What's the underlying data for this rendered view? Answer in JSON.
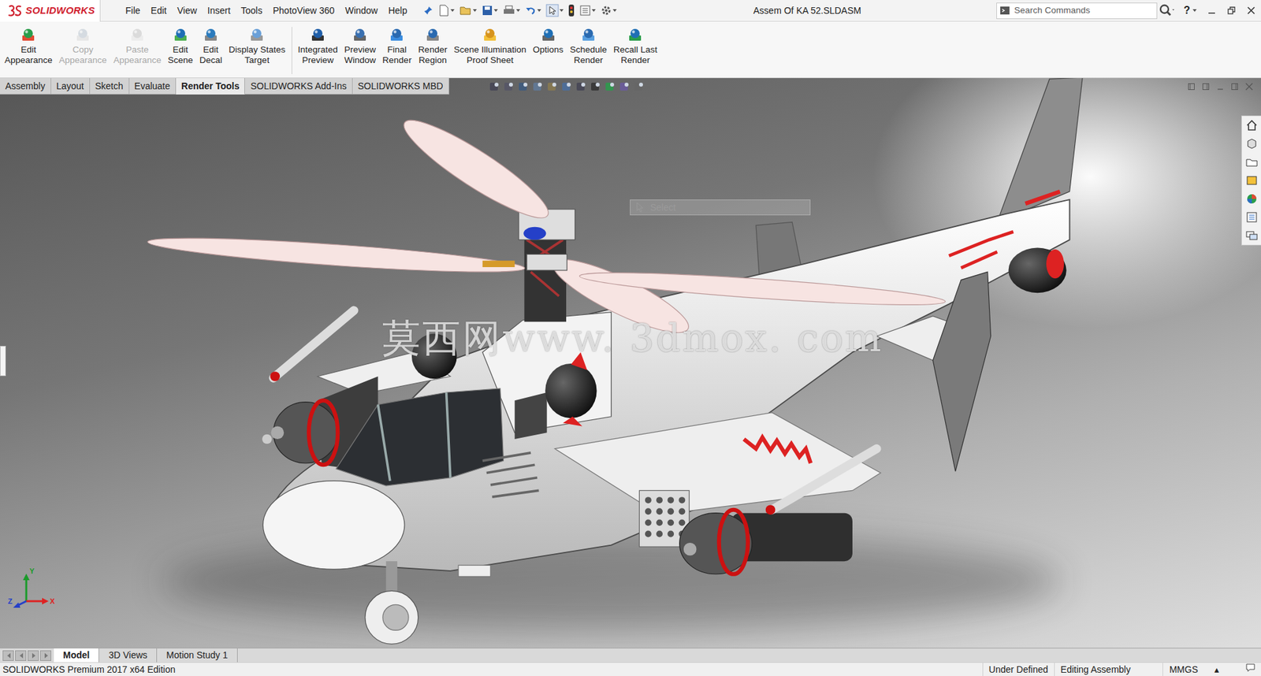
{
  "app": {
    "logo": "SOLIDWORKS"
  },
  "menu": [
    "File",
    "Edit",
    "View",
    "Insert",
    "Tools",
    "PhotoView 360",
    "Window",
    "Help"
  ],
  "window": {
    "title": "Assem Of KA 52.SLDASM"
  },
  "search": {
    "placeholder": "Search Commands"
  },
  "help": "?",
  "ribbon": {
    "groups": [
      [
        {
          "lines": [
            "Edit",
            "Appearance"
          ],
          "disabled": false
        },
        {
          "lines": [
            "Copy",
            "Appearance"
          ],
          "disabled": true
        },
        {
          "lines": [
            "Paste",
            "Appearance"
          ],
          "disabled": true
        },
        {
          "lines": [
            "Edit",
            "Scene"
          ],
          "disabled": false
        },
        {
          "lines": [
            "Edit",
            "Decal"
          ],
          "disabled": false
        },
        {
          "lines": [
            "Display States",
            "Target"
          ],
          "disabled": false
        }
      ],
      [
        {
          "lines": [
            "Integrated",
            "Preview"
          ],
          "disabled": false
        },
        {
          "lines": [
            "Preview",
            "Window"
          ],
          "disabled": false
        },
        {
          "lines": [
            "Final",
            "Render"
          ],
          "disabled": false
        },
        {
          "lines": [
            "Render",
            "Region"
          ],
          "disabled": false
        },
        {
          "lines": [
            "Scene Illumination",
            "Proof Sheet"
          ],
          "disabled": false
        },
        {
          "lines": [
            "Options"
          ],
          "disabled": false
        },
        {
          "lines": [
            "Schedule",
            "Render"
          ],
          "disabled": false
        },
        {
          "lines": [
            "Recall Last",
            "Render"
          ],
          "disabled": false
        }
      ]
    ]
  },
  "tabs": [
    {
      "label": "Assembly",
      "selected": false
    },
    {
      "label": "Layout",
      "selected": false
    },
    {
      "label": "Sketch",
      "selected": false
    },
    {
      "label": "Evaluate",
      "selected": false
    },
    {
      "label": "Render Tools",
      "selected": true
    },
    {
      "label": "SOLIDWORKS Add-Ins",
      "selected": false
    },
    {
      "label": "SOLIDWORKS MBD",
      "selected": false
    }
  ],
  "viewport": {
    "tooltip": "Select",
    "watermark": "莫西网www. 3dmox. com"
  },
  "triad": {
    "y": "Y",
    "x": "X",
    "z": "Z"
  },
  "bottom_tabs": [
    {
      "label": "Model",
      "selected": true
    },
    {
      "label": "3D Views",
      "selected": false
    },
    {
      "label": "Motion Study 1",
      "selected": false
    }
  ],
  "status_bar": {
    "edition": "SOLIDWORKS Premium 2017 x64 Edition",
    "items": [
      "Under Defined",
      "Editing Assembly",
      "MMGS"
    ],
    "units_arrow": "▴"
  }
}
